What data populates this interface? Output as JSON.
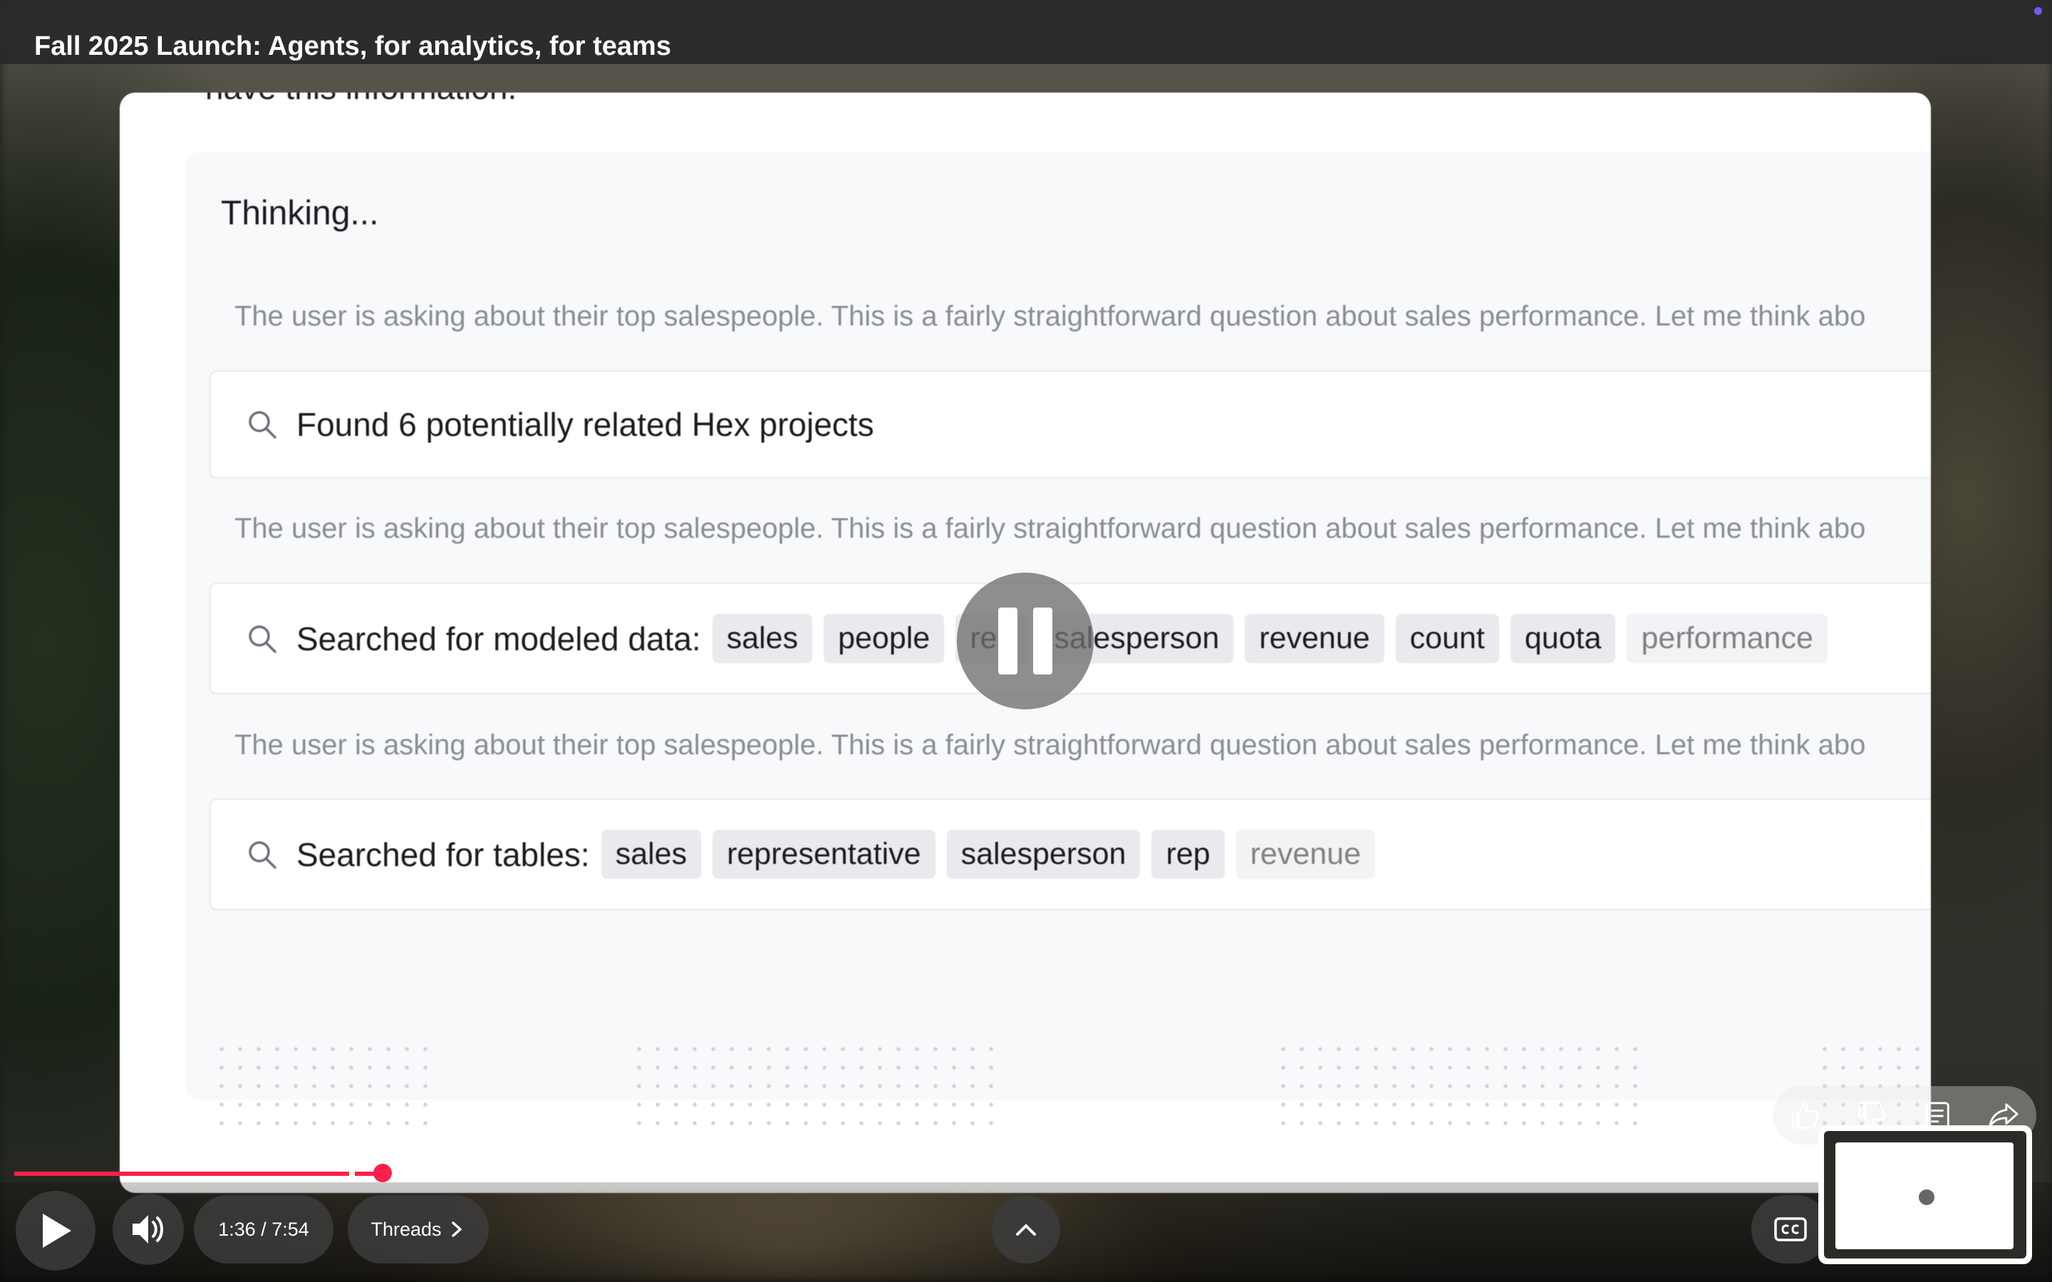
{
  "video": {
    "title": "Fall 2025 Launch: Agents, for analytics, for teams",
    "clipped_line": "have this information."
  },
  "agent_panel": {
    "status": "Thinking...",
    "thoughts": [
      "The user is asking about their top salespeople. This is a fairly straightforward question about sales performance. Let me think abo",
      "The user is asking about their top salespeople. This is a fairly straightforward question about sales performance. Let me think abo",
      "The user is asking about their top salespeople. This is a fairly straightforward question about sales performance. Let me think abo"
    ],
    "steps": [
      {
        "label": "Found 6 potentially related Hex projects",
        "chips": []
      },
      {
        "label": "Searched for modeled data:",
        "chips": [
          "sales",
          "people",
          "rep",
          "salesperson",
          "revenue",
          "count",
          "quota",
          "performance"
        ]
      },
      {
        "label": "Searched for tables:",
        "chips": [
          "sales",
          "representative",
          "salesperson",
          "rep",
          "revenue"
        ]
      }
    ]
  },
  "player": {
    "time": "1:36 / 7:54",
    "threads_label": "Threads",
    "progress_fraction": 0.2034,
    "state": "paused"
  },
  "icons": {
    "play": "play-icon",
    "volume": "volume-icon",
    "chevron_up": "chevron-up-icon",
    "captions": "closed-captions-icon",
    "thumbs_up": "thumbs-up-icon",
    "thumbs_down": "thumbs-down-icon",
    "transcript": "transcript-icon",
    "share": "share-icon",
    "search": "search-icon",
    "pause": "pause-icon"
  },
  "colors": {
    "progress_played": "#ff1f4b",
    "accent_dot": "#6a5cff"
  }
}
